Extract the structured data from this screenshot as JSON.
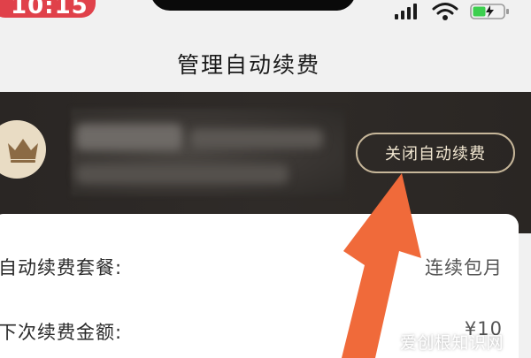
{
  "status_bar": {
    "time": "10:15",
    "pill_color": "#e0414a",
    "icons": [
      "signal-icon",
      "wifi-icon",
      "battery-charging-icon"
    ]
  },
  "header": {
    "title": "管理自动续费"
  },
  "banner": {
    "icon": "crown-icon",
    "close_button_label": "关闭自动续费",
    "accent_color": "#c7b79a"
  },
  "details": {
    "rows": [
      {
        "label": "自动续费套餐:",
        "value": "连续包月"
      },
      {
        "label": "下次续费金额:",
        "value": "¥10"
      }
    ]
  },
  "annotation": {
    "arrow_icon": "pointer-arrow-icon",
    "arrow_color": "#f06a3a"
  },
  "watermark": {
    "text": "爱创根知识网"
  }
}
